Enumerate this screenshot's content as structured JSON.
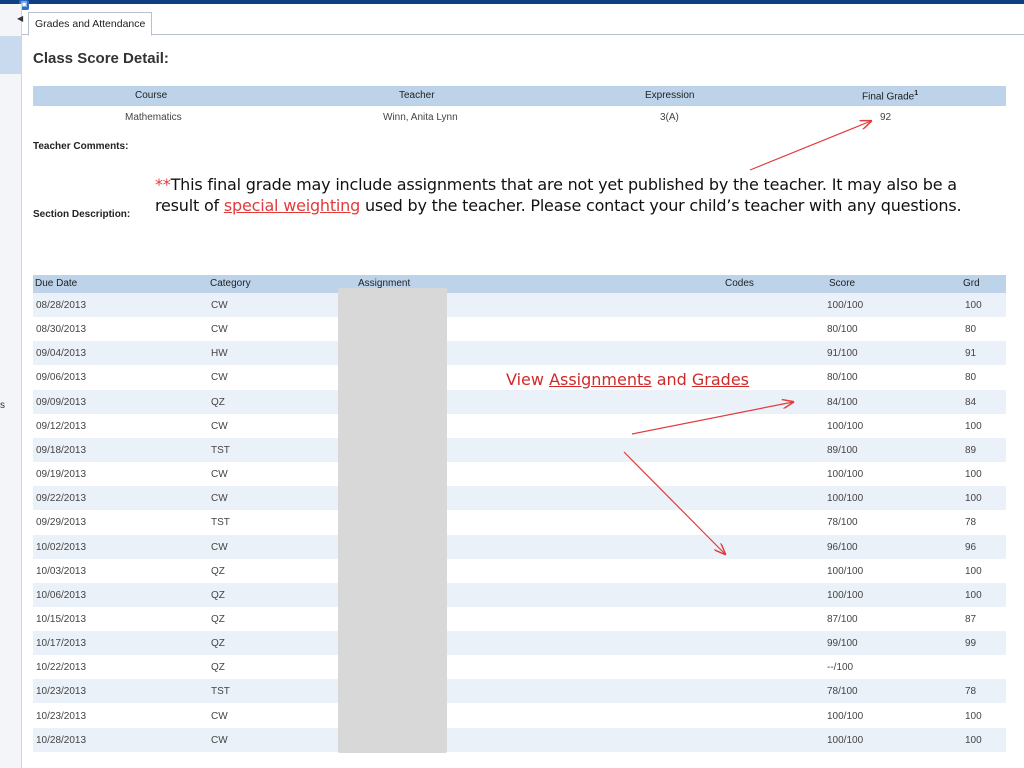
{
  "tab": {
    "label": "Grades and Attendance"
  },
  "page": {
    "title": "Class Score Detail:"
  },
  "summary": {
    "headers": {
      "course": "Course",
      "teacher": "Teacher",
      "expression": "Expression",
      "final_grade": "Final Grade",
      "final_grade_sup": "1"
    },
    "row": {
      "course": "Mathematics",
      "teacher": "Winn, Anita Lynn",
      "expression": "3(A)",
      "final_grade": "92"
    }
  },
  "labels": {
    "teacher_comments": "Teacher Comments:",
    "section_description": "Section Description:"
  },
  "callout": {
    "stars": "**",
    "line1": "This final grade may include assignments that are not yet published by the teacher. It may also be a",
    "line2_pre": "result of ",
    "line2_link": "special weighting",
    "line2_post": " used by the teacher.  Please contact your child’s teacher with any questions."
  },
  "view_note": {
    "pre": "View ",
    "link1": "Assignments",
    "mid": " and ",
    "link2": "Grades"
  },
  "assignments": {
    "headers": {
      "due_date": "Due Date",
      "category": "Category",
      "assignment": "Assignment",
      "codes": "Codes",
      "score": "Score",
      "grd": "Grd"
    },
    "rows": [
      {
        "date": "08/28/2013",
        "cat": "CW",
        "score": "100/100",
        "grd": "100"
      },
      {
        "date": "08/30/2013",
        "cat": "CW",
        "score": "80/100",
        "grd": "80"
      },
      {
        "date": "09/04/2013",
        "cat": "HW",
        "score": "91/100",
        "grd": "91"
      },
      {
        "date": "09/06/2013",
        "cat": "CW",
        "score": "80/100",
        "grd": "80"
      },
      {
        "date": "09/09/2013",
        "cat": "QZ",
        "score": "84/100",
        "grd": "84"
      },
      {
        "date": "09/12/2013",
        "cat": "CW",
        "score": "100/100",
        "grd": "100"
      },
      {
        "date": "09/18/2013",
        "cat": "TST",
        "score": "89/100",
        "grd": "89"
      },
      {
        "date": "09/19/2013",
        "cat": "CW",
        "score": "100/100",
        "grd": "100"
      },
      {
        "date": "09/22/2013",
        "cat": "CW",
        "score": "100/100",
        "grd": "100"
      },
      {
        "date": "09/29/2013",
        "cat": "TST",
        "score": "78/100",
        "grd": "78"
      },
      {
        "date": "10/02/2013",
        "cat": "CW",
        "score": "96/100",
        "grd": "96"
      },
      {
        "date": "10/03/2013",
        "cat": "QZ",
        "score": "100/100",
        "grd": "100"
      },
      {
        "date": "10/06/2013",
        "cat": "QZ",
        "score": "100/100",
        "grd": "100"
      },
      {
        "date": "10/15/2013",
        "cat": "QZ",
        "score": "87/100",
        "grd": "87"
      },
      {
        "date": "10/17/2013",
        "cat": "QZ",
        "score": "99/100",
        "grd": "99"
      },
      {
        "date": "10/22/2013",
        "cat": "QZ",
        "score": "--/100",
        "grd": ""
      },
      {
        "date": "10/23/2013",
        "cat": "TST",
        "score": "78/100",
        "grd": "78"
      },
      {
        "date": "10/23/2013",
        "cat": "CW",
        "score": "100/100",
        "grd": "100"
      },
      {
        "date": "10/28/2013",
        "cat": "CW",
        "score": "100/100",
        "grd": "100"
      }
    ]
  },
  "sidebar": {
    "peek_text": "s"
  },
  "colors": {
    "header_bg": "#bcd3ea",
    "row_alt": "#eaf1f8",
    "annotation_red": "#e23b3b",
    "top_bar": "#0e3f82"
  }
}
